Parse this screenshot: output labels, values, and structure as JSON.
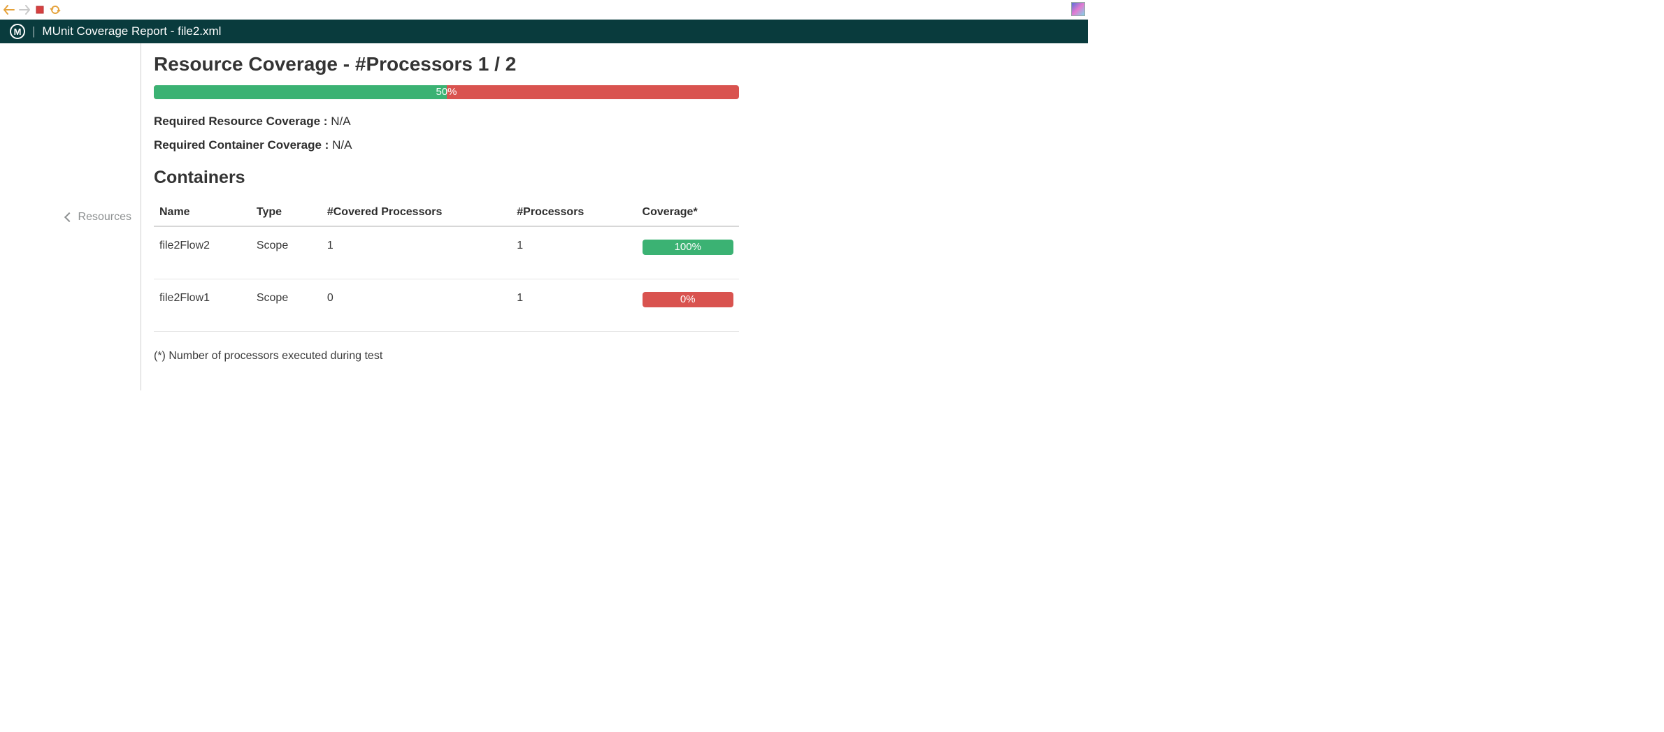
{
  "header": {
    "title": "MUnit Coverage Report - file2.xml"
  },
  "sidebar": {
    "breadcrumb_label": "Resources"
  },
  "main": {
    "title": "Resource Coverage - #Processors 1 / 2",
    "progress": {
      "percent": 50,
      "label": "50%"
    },
    "required_resource": {
      "label": "Required Resource Coverage : ",
      "value": "N/A"
    },
    "required_container": {
      "label": "Required Container Coverage : ",
      "value": "N/A"
    },
    "containers_heading": "Containers",
    "columns": {
      "name": "Name",
      "type": "Type",
      "covered": "#Covered Processors",
      "processors": "#Processors",
      "coverage": "Coverage*"
    },
    "rows": [
      {
        "name": "file2Flow2",
        "type": "Scope",
        "covered": "1",
        "processors": "1",
        "coverage_label": "100%",
        "coverage_class": "badge-green"
      },
      {
        "name": "file2Flow1",
        "type": "Scope",
        "covered": "0",
        "processors": "1",
        "coverage_label": "0%",
        "coverage_class": "badge-red"
      }
    ],
    "footnote": "(*) Number of processors executed during test"
  }
}
